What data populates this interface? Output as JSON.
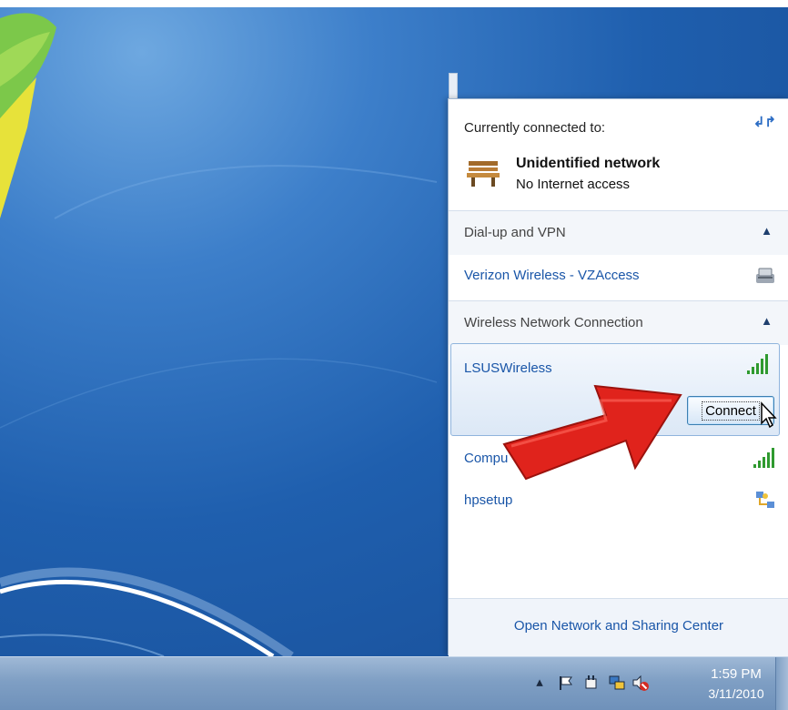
{
  "flyout": {
    "currently_connected_label": "Currently connected to:",
    "current_network": {
      "name": "Unidentified network",
      "status": "No Internet access",
      "icon": "bench-network-icon"
    },
    "sections": [
      {
        "header": "Dial-up and VPN",
        "networks": [
          {
            "name": "Verizon Wireless - VZAccess",
            "icon": "dialup-modem-icon"
          }
        ]
      },
      {
        "header": "Wireless Network Connection",
        "networks": [
          {
            "name": "LSUSWireless",
            "icon": "signal-bars-icon",
            "selected": true,
            "action": "Connect"
          },
          {
            "name": "Compu",
            "icon": "signal-bars-icon"
          },
          {
            "name": "hpsetup",
            "icon": "adhoc-network-icon"
          }
        ]
      }
    ],
    "footer_link": "Open Network and Sharing Center"
  },
  "taskbar": {
    "time": "1:59 PM",
    "date": "3/11/2010",
    "tray_icons": [
      "show-hidden-icon",
      "action-center-flag-icon",
      "power-icon",
      "network-icon",
      "volume-muted-icon"
    ]
  },
  "colors": {
    "link": "#1a56a8",
    "arrow": "#e0231c",
    "desktop": "#1f5fae"
  }
}
